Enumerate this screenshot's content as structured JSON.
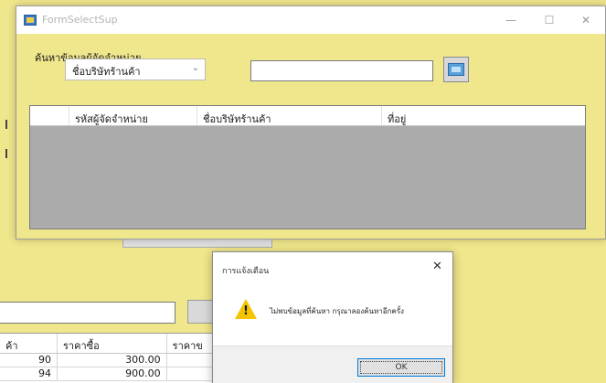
{
  "form": {
    "title": "FormSelectSup",
    "group_label": "ค้นหาข้อมูลผู้จัดจำหน่าย",
    "search_by": "ชื่อบริษัทร้านค้า",
    "search_value": "",
    "grid_columns": [
      "รหัสผู้จัดจำหน่าย",
      "ชื่อบริษัทร้านค้า",
      "ที่อยู่"
    ],
    "window_controls": {
      "minimize": "—",
      "maximize": "☐",
      "close": "✕"
    }
  },
  "background": {
    "grid_columns": [
      "ค้า",
      "ราคาซื้อ",
      "ราคาข"
    ],
    "rows": [
      {
        "qty": "90",
        "price": "300.00"
      },
      {
        "qty": "94",
        "price": "900.00"
      }
    ]
  },
  "messagebox": {
    "title": "การแจ้งเตือน",
    "text": "ไม่พบข้อมูลที่ค้นหา กรุณาลองค้นหาอีกครั้ง",
    "ok_label": "OK",
    "close": "✕"
  },
  "colors": {
    "background": "#f0e68c",
    "grid_empty": "#ababab",
    "warning": "#f5c400",
    "focus": "#0078d7"
  }
}
